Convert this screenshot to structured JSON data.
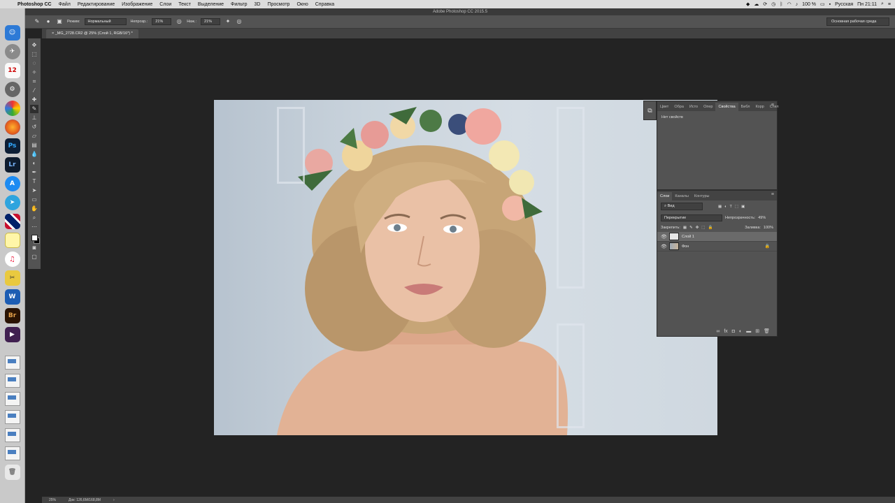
{
  "menubar": {
    "app_name": "Photoshop CC",
    "items": [
      "Файл",
      "Редактирование",
      "Изображение",
      "Слои",
      "Текст",
      "Выделение",
      "Фильтр",
      "3D",
      "Просмотр",
      "Окно",
      "Справка"
    ],
    "battery": "100 %",
    "language": "Русская",
    "clock": "Пн 21:11"
  },
  "window": {
    "title": "Adobe Photoshop CC 2015.5"
  },
  "options_bar": {
    "mode_label": "Режим:",
    "mode_value": "Нормальный",
    "opacity_label": "Непрозр.:",
    "opacity_value": "21%",
    "pressure_label": "Наж.:",
    "pressure_value": "21%",
    "workspace": "Основная рабочая среда"
  },
  "document_tab": {
    "label": "_MG_2728.CR2 @ 25% (Слой 1, RGB/16*) *"
  },
  "properties_panel": {
    "tabs": [
      "Цвет",
      "Обра",
      "Исто",
      "Опер",
      "Свойства",
      "Библ",
      "Корр",
      "Стил"
    ],
    "active_tab": "Свойства",
    "body_text": "Нет свойств"
  },
  "layers_panel": {
    "tabs": [
      "Слои",
      "Каналы",
      "Контуры"
    ],
    "active_tab": "Слои",
    "filter_value": "Вид",
    "blend_mode": "Перекрытие",
    "opacity_label": "Непрозрачность:",
    "opacity_value": "49%",
    "lock_label": "Закрепить:",
    "fill_label": "Заливка:",
    "fill_value": "100%",
    "layers": [
      {
        "name": "Слой 1",
        "selected": true
      },
      {
        "name": "Фон",
        "selected": false
      }
    ]
  },
  "statusbar": {
    "zoom": "25%",
    "doc_info": "Док: 126,6M/168,8M"
  },
  "colors": {
    "bg": "#232323",
    "panel": "#535353",
    "dock": "#c9c9c9",
    "menubar": "#dcdcdc"
  }
}
